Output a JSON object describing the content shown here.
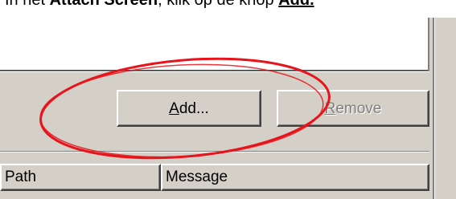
{
  "instruction": {
    "prefix": "In het ",
    "dialog_name": "Attach Screen",
    "middle": ", klik op de knop ",
    "button_ref": "Add.",
    "suffix": ""
  },
  "buttons": {
    "add_prefix": "",
    "add_mnemonic": "A",
    "add_rest": "dd...",
    "remove_prefix": "",
    "remove_mnemonic": "R",
    "remove_rest": "emove"
  },
  "columns": [
    {
      "label": "Path"
    },
    {
      "label": "Message"
    }
  ],
  "annotation": {
    "color": "#e8141c"
  }
}
